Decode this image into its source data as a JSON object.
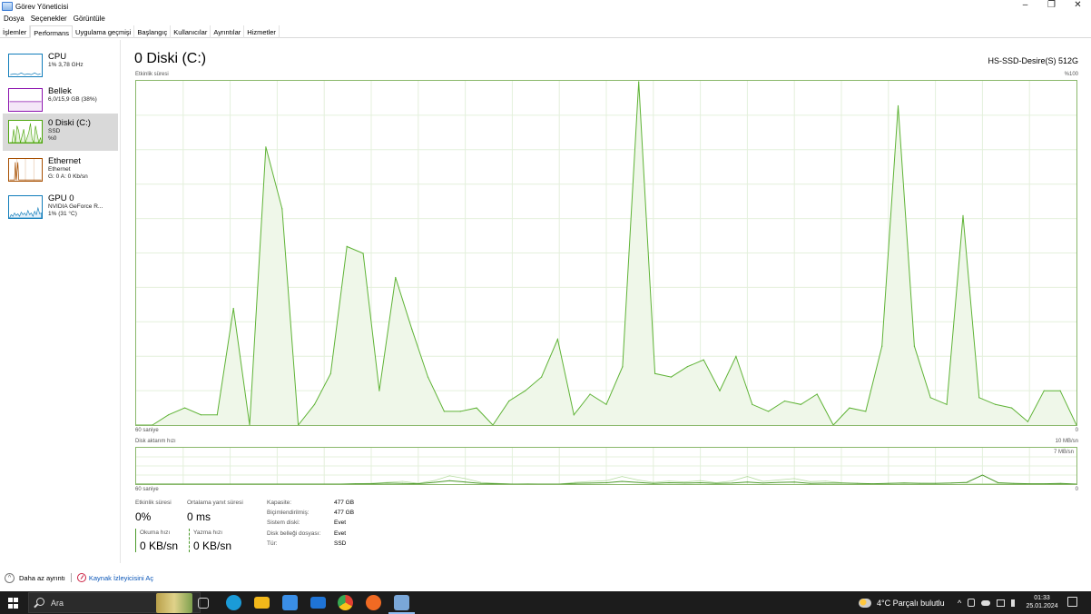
{
  "window": {
    "title": "Görev Yöneticisi",
    "controls": {
      "minimize": "–",
      "restore": "❐",
      "close": "✕"
    }
  },
  "menu": [
    "Dosya",
    "Seçenekler",
    "Görüntüle"
  ],
  "tabs": [
    {
      "label": "İşlemler",
      "active": false
    },
    {
      "label": "Performans",
      "active": true
    },
    {
      "label": "Uygulama geçmişi",
      "active": false
    },
    {
      "label": "Başlangıç",
      "active": false
    },
    {
      "label": "Kullanıcılar",
      "active": false
    },
    {
      "label": "Ayrıntılar",
      "active": false
    },
    {
      "label": "Hizmetler",
      "active": false
    }
  ],
  "sidebar": {
    "items": [
      {
        "title": "CPU",
        "sub1": "1% 3,78 GHz",
        "sub2": "",
        "sub3": "",
        "color": "#117dbb",
        "selected": false
      },
      {
        "title": "Bellek",
        "sub1": "6,0/15,9 GB (38%)",
        "sub2": "",
        "sub3": "",
        "color": "#8b12ae",
        "selected": false
      },
      {
        "title": "0 Diski (C:)",
        "sub1": "SSD",
        "sub2": "%0",
        "sub3": "",
        "color": "#4da60c",
        "selected": true
      },
      {
        "title": "Ethernet",
        "sub1": "Ethernet",
        "sub2": "G: 0 A: 0 Kb/sn",
        "sub3": "",
        "color": "#a74f01",
        "selected": false
      },
      {
        "title": "GPU 0",
        "sub1": "NVIDIA GeForce R...",
        "sub2": "1% (31 °C)",
        "sub3": "",
        "color": "#117dbb",
        "selected": false
      }
    ]
  },
  "disk": {
    "title": "0 Diski (C:)",
    "model": "HS-SSD-Desire(S) 512G",
    "activity_label": "Etkinlik süresi",
    "activity_max": "%100",
    "time_left": "60 saniye",
    "time_right": "0",
    "transfer_label": "Disk aktarım hızı",
    "transfer_max": "10 MB/sn",
    "transfer_inner_max": "7 MB/sn",
    "transfer_time_left": "60 saniye",
    "transfer_time_right": "0",
    "stats": {
      "activity_label": "Etkinlik süresi",
      "activity_value": "0%",
      "response_label": "Ortalama yanıt süresi",
      "response_value": "0 ms",
      "read_label": "Okuma hızı",
      "read_value": "0 KB/sn",
      "write_label": "Yazma hızı",
      "write_value": "0 KB/sn"
    },
    "info": [
      {
        "label": "Kapasite:",
        "value": "477 GB"
      },
      {
        "label": "Biçimlendirilmiş:",
        "value": "477 GB"
      },
      {
        "label": "Sistem diski:",
        "value": "Evet"
      },
      {
        "label": "Disk belleği dosyası:",
        "value": "Evet"
      },
      {
        "label": "Tür:",
        "value": "SSD"
      }
    ]
  },
  "chart_data": [
    {
      "type": "area",
      "title": "Etkinlik süresi",
      "ylim": [
        0,
        100
      ],
      "xlim": [
        60,
        0
      ],
      "x_unit": "saniye",
      "y_unit": "%",
      "x": [
        60,
        59,
        58,
        57,
        56,
        55,
        54,
        53,
        52,
        51,
        50,
        49,
        48,
        47,
        46,
        45,
        44,
        43,
        42,
        41,
        40,
        39,
        38,
        37,
        36,
        35,
        34,
        33,
        32,
        31,
        30,
        29,
        28,
        27,
        26,
        25,
        24,
        23,
        22,
        21,
        20,
        19,
        18,
        17,
        16,
        15,
        14,
        13,
        12,
        11,
        10,
        9,
        8,
        7,
        6,
        5,
        4,
        3,
        2,
        1,
        0
      ],
      "values": [
        0,
        0,
        3,
        5,
        3,
        3,
        34,
        0,
        81,
        63,
        0,
        6,
        15,
        52,
        50,
        10,
        43,
        28,
        14,
        4,
        4,
        5,
        0,
        7,
        10,
        14,
        25,
        3,
        9,
        6,
        17,
        100,
        15,
        14,
        17,
        19,
        10,
        20,
        6,
        4,
        7,
        6,
        9,
        0,
        5,
        4,
        23,
        93,
        23,
        8,
        6,
        61,
        8,
        6,
        5,
        1,
        10,
        10,
        0
      ]
    },
    {
      "type": "line",
      "title": "Disk aktarım hızı",
      "ylim": [
        0,
        10
      ],
      "xlim": [
        60,
        0
      ],
      "x_unit": "saniye",
      "y_unit": "MB/sn",
      "series": [
        {
          "values": [
            0,
            0,
            0,
            0,
            0,
            0,
            0,
            0,
            0,
            0,
            0,
            0,
            0,
            0,
            0.1,
            0.2,
            0.5,
            0.8,
            0.2,
            1.0,
            2.4,
            1.6,
            0.5,
            0.2,
            0,
            0.1,
            0,
            0,
            0.5,
            0.8,
            1.0,
            2.2,
            1.2,
            0.5,
            0.9,
            0.6,
            1.0,
            0.4,
            0.9,
            2.2,
            0.8,
            1.2,
            1.6,
            0.7,
            0.9,
            0.4,
            0.2,
            0,
            0.2,
            0.4,
            0.3,
            0.2,
            0.4,
            0.3,
            0.1,
            0.2,
            0.1,
            0,
            0,
            0.1,
            0
          ]
        },
        {
          "values": [
            0,
            0,
            0,
            0,
            0,
            0,
            0,
            0,
            0,
            0,
            0,
            0,
            0,
            0,
            0.1,
            0.1,
            0.3,
            0.2,
            0.1,
            0.5,
            1.0,
            0.6,
            0.2,
            0.1,
            0,
            0,
            0,
            0,
            0.2,
            0.3,
            0.4,
            0.8,
            0.5,
            0.2,
            0.4,
            0.3,
            0.4,
            0.2,
            0.3,
            0.6,
            0.3,
            0.5,
            0.6,
            0.2,
            0.3,
            0.3,
            0.2,
            0.1,
            0.2,
            0.3,
            0.2,
            0.2,
            0.3,
            0.5,
            2.6,
            0.4,
            0.2,
            0.1,
            0.1,
            0.2,
            0
          ]
        }
      ]
    }
  ],
  "footer": {
    "less_details": "Daha az ayrıntı",
    "resource_monitor": "Kaynak İzleyicisini Aç"
  },
  "taskbar": {
    "search_placeholder": "Ara",
    "weather": "4°C  Parçalı bulutlu",
    "time": "01:33",
    "date": "25.01.2024",
    "app_icons": [
      {
        "name": "task-view-icon",
        "color": "#d0d0d0"
      },
      {
        "name": "edge-icon",
        "color": "#1b9bd8"
      },
      {
        "name": "file-explorer-icon",
        "color": "#f2b81a"
      },
      {
        "name": "store-icon",
        "color": "#3a8ee6"
      },
      {
        "name": "mail-icon",
        "color": "#1f74d6"
      },
      {
        "name": "chrome-icon",
        "color": "#e34133"
      },
      {
        "name": "origin-icon",
        "color": "#f06a23"
      },
      {
        "name": "task-manager-icon",
        "color": "#7aa7d8"
      }
    ]
  }
}
